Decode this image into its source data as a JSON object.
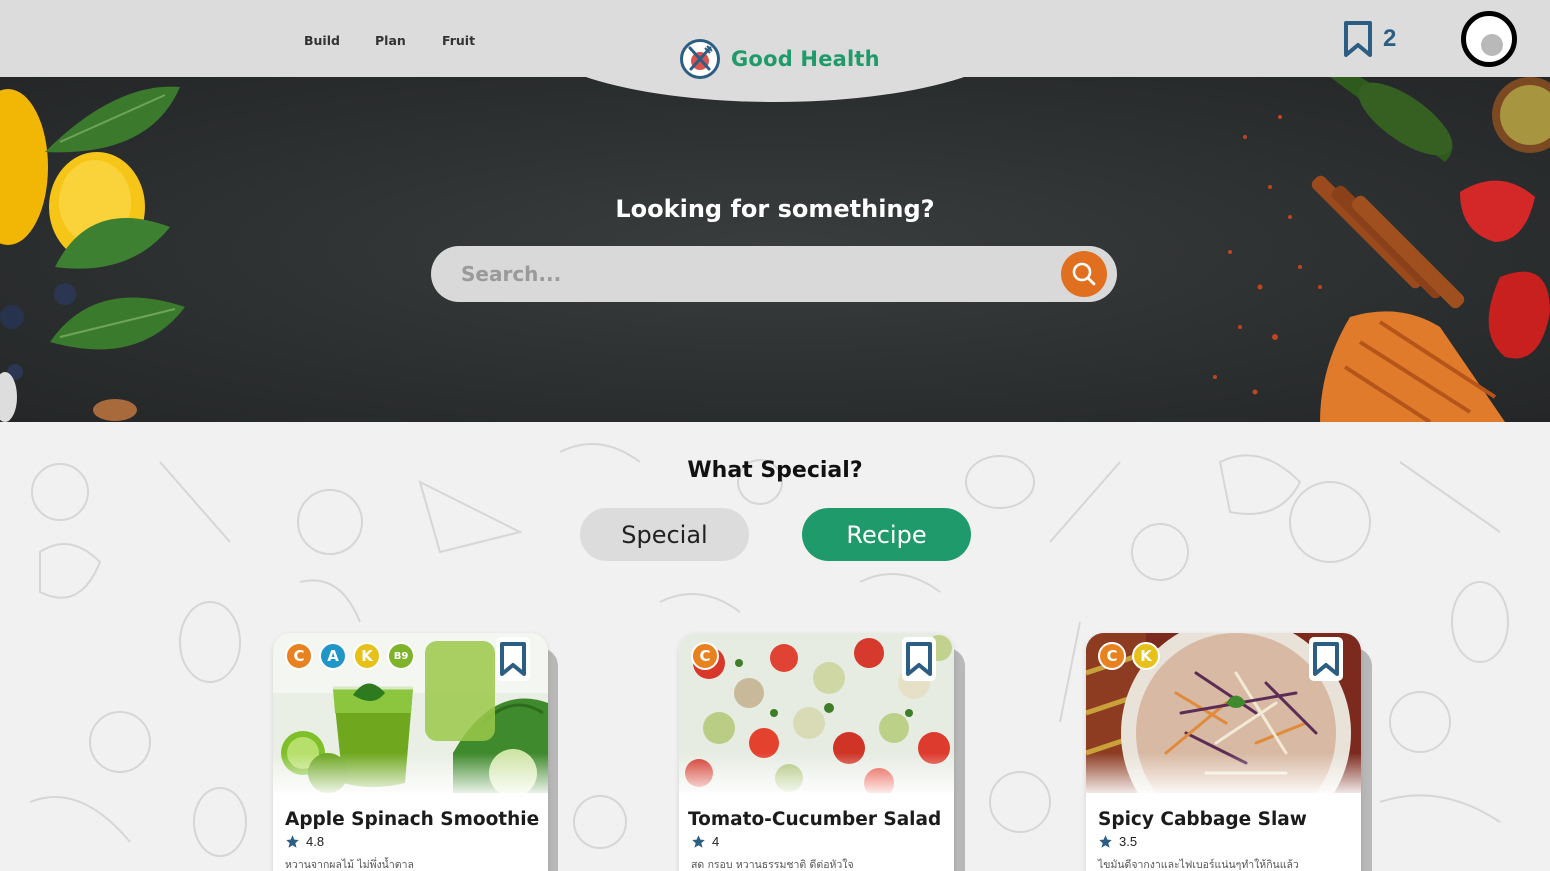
{
  "nav": {
    "build": "Build",
    "plan": "Plan",
    "fruit": "Fruit"
  },
  "brand": {
    "name": "Good Health"
  },
  "bookmarks": {
    "count": "2"
  },
  "hero": {
    "title": "Looking for something?"
  },
  "search": {
    "placeholder": "Search..."
  },
  "section": {
    "title": "What Special?"
  },
  "tabs": {
    "special": "Special",
    "recipe": "Recipe",
    "active": "recipe"
  },
  "colors": {
    "accent_green": "#1f9a6b",
    "accent_orange": "#e0701f",
    "navy": "#2c5d82"
  },
  "cards": [
    {
      "title": "Apple Spinach Smoothie",
      "rating": "4.8",
      "description": "หวานจากผลไม้ ไม่พึ่งน้ำตาล",
      "badges": [
        "C",
        "A",
        "K",
        "B9"
      ]
    },
    {
      "title": "Tomato-Cucumber Salad",
      "rating": "4",
      "description": "สด กรอบ หวานธรรมชาติ ดีต่อหัวใจ",
      "badges": [
        "C"
      ]
    },
    {
      "title": "Spicy Cabbage Slaw",
      "rating": "3.5",
      "description": "ไขมันดีจากงาและไฟเบอร์แน่นๆทำให้กินแล้ว",
      "badges": [
        "C",
        "K"
      ]
    }
  ]
}
